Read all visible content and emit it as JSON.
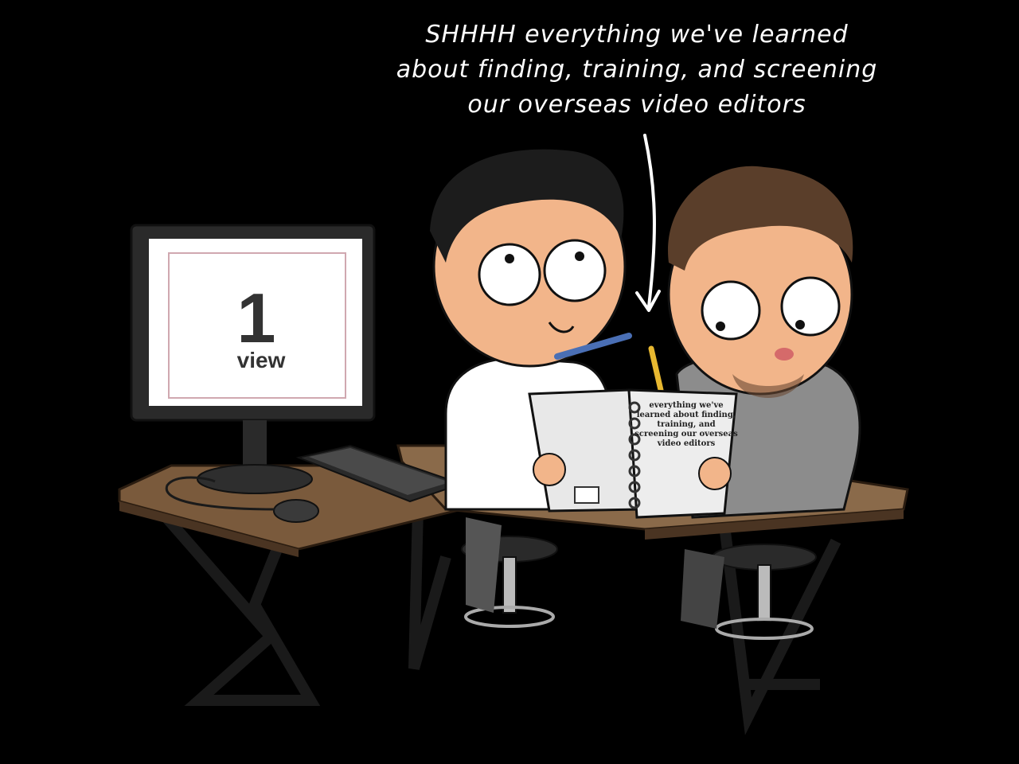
{
  "caption": {
    "line1": "SHHHH everything we've learned",
    "line2": "about finding, training, and screening",
    "line3": "our overseas video editors"
  },
  "monitor": {
    "count": "1",
    "unit": "view"
  },
  "notebook": {
    "line1": "everything we've",
    "line2": "learned about finding,",
    "line3": "training, and",
    "line4": "screening our overseas",
    "line5": "video editors"
  },
  "colors": {
    "background": "#000000",
    "desk": "#8a6a4a",
    "skin": "#f2b58a",
    "hoodie": "#8c8c8c"
  }
}
